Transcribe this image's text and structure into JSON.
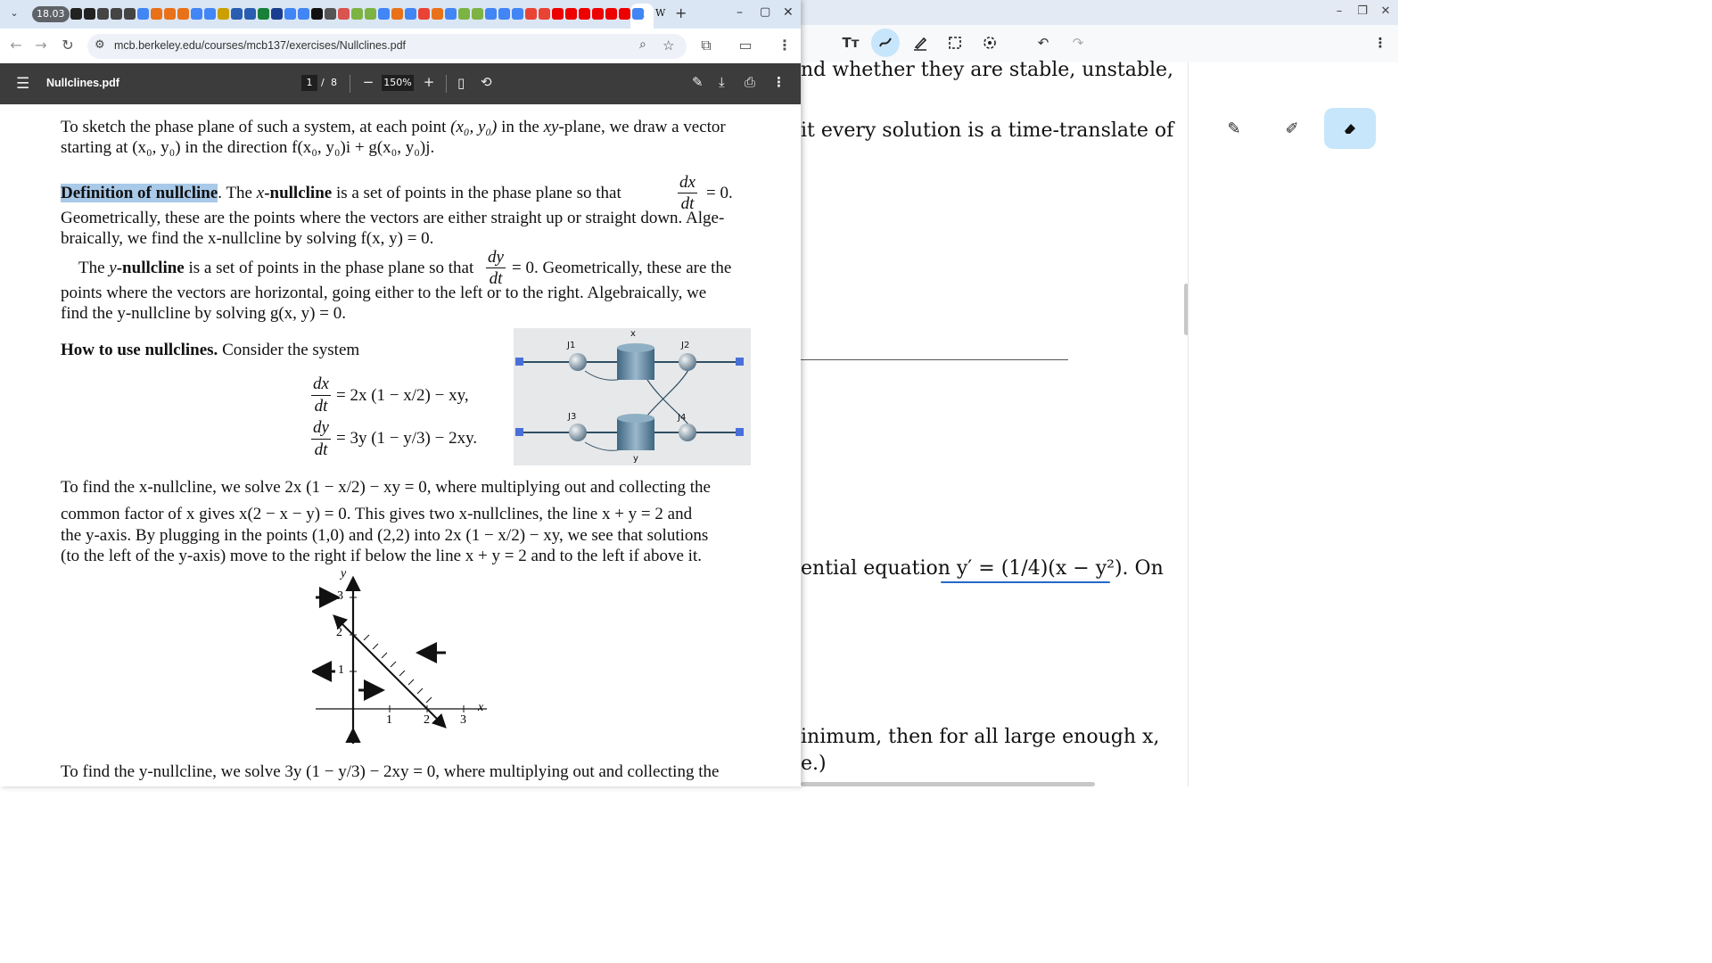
{
  "back_window": {
    "window_controls": [
      "–",
      "❐",
      "✕"
    ],
    "toolbar_tools": [
      "text-tool",
      "highlighter-tool",
      "pen-tool",
      "select-tool",
      "lasso-tool",
      "undo",
      "redo",
      "more"
    ],
    "lines": [
      "nd whether they are stable, unstable,",
      "it every solution is a time-translate of",
      "ential equation y′ = (1/4)(x − y²). On",
      "inimum, then for all large enough x,",
      "e.)"
    ]
  },
  "browser": {
    "tab_time": "18.03",
    "active_tab_close": "✕",
    "new_tab": "+",
    "window_controls": [
      "–",
      "▢",
      "✕"
    ],
    "url": "mcb.berkeley.edu/courses/mcb137/exercises/Nullclines.pdf"
  },
  "pdf_toolbar": {
    "filename": "Nullclines.pdf",
    "page_current": "1",
    "page_sep": "/",
    "page_total": "8",
    "zoom": "150%",
    "zoom_out": "−",
    "zoom_in": "+"
  },
  "document": {
    "para1_a": "To sketch the phase plane of such a system, at each point ",
    "para1_b": "(x₀, y₀)",
    "para1_c": " in the ",
    "para1_d": "xy",
    "para1_e": "-plane, we draw a vector",
    "para1_line2": "starting at (x₀, y₀) in the direction f(x₀, y₀)i + g(x₀, y₀)j.",
    "def_title": "Definition of nullcline",
    "def_a": ". The ",
    "def_b": "x",
    "def_c": "-nullcline",
    "def_d": " is a set of points in the phase plane so that",
    "def_frac_num": "dx",
    "def_frac_den": "dt",
    "def_eq": "= 0.",
    "def_line2": "Geometrically, these are the points where the vectors are either straight up or straight down. Alge-",
    "def_line3": "braically, we find the x-nullcline by solving f(x, y) = 0.",
    "y_a": "The ",
    "y_b": "y",
    "y_c": "-nullcline",
    "y_d": " is a set of points in the phase plane so that",
    "y_frac_num": "dy",
    "y_frac_den": "dt",
    "y_e": "= 0. Geometrically, these are the",
    "y_line2": "points where the vectors are horizontal, going either to the left or to the right. Algebraically, we",
    "y_line3": "find the y-nullcline by solving g(x, y) = 0.",
    "how_title": "How to use nullclines.",
    "how_text": " Consider the system",
    "eq1": "= 2x (1 − x/2) − xy,",
    "eq2": "= 3y (1 − y/3) − 2xy.",
    "xfind_line1": "To find the x-nullcline, we solve 2x (1 − x/2) − xy = 0, where multiplying out and collecting the",
    "xfind_line2": "common factor of x gives x(2 − x − y) = 0. This gives two x-nullclines, the line x + y = 2 and",
    "xfind_line3": "the y-axis. By plugging in the points (1,0) and (2,2) into 2x (1 − x/2) − xy, we see that solutions",
    "xfind_line4": "(to the left of the y-axis) move to the right if below the line x + y = 2 and to the left if above it.",
    "yfind_line1": "To find the y-nullcline, we solve 3y (1 − y/3) − 2xy = 0, where multiplying out and collecting the"
  },
  "diagram": {
    "labels": [
      "x",
      "J1",
      "J2",
      "J3",
      "J4",
      "y"
    ]
  },
  "graph": {
    "y_label": "y",
    "x_label": "x",
    "y_ticks": [
      "3",
      "2",
      "1"
    ],
    "x_ticks": [
      "1",
      "2",
      "3"
    ]
  }
}
